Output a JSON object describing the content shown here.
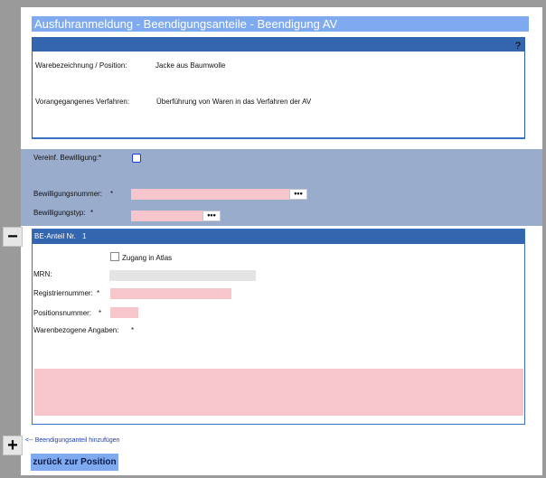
{
  "window": {
    "title": "Ausfuhranmeldung - Beendigungsanteile - Beendigung AV",
    "help_label": "?"
  },
  "position_info": {
    "warenbezeichnung_label": "Warebezeichnung / Position:",
    "warenbezeichnung_value": "Jacke aus Baumwolle",
    "verfahren_label": "Vorangegangenes Verfahren:",
    "verfahren_value": "Überführung von Waren in das Verfahren der AV"
  },
  "bewilligung": {
    "vereinf_label": "Vereinf. Bewilligung:*",
    "vereinf_checked": false,
    "nummer_label": "Bewilligungsnummer:",
    "nummer_required": "*",
    "nummer_value": "",
    "typ_label": "Bewilligungstyp:",
    "typ_required": "*",
    "typ_value": "",
    "lookup_label": "•••"
  },
  "be_anteil": {
    "header_label": "BE-Anteil Nr.",
    "header_number": "1",
    "zugang_label": "Zugang in Atlas",
    "zugang_checked": false,
    "mrn_label": "MRN:",
    "mrn_value": "",
    "registrier_label": "Registriernummer:",
    "registrier_required": "*",
    "registrier_value": "",
    "positions_label": "Positionsnummer:",
    "positions_required": "*",
    "positions_value": "",
    "warenbezogen_label": "Warenbezogene Angaben:",
    "warenbezogen_required": "*",
    "warenbezogen_value": ""
  },
  "controls": {
    "remove_symbol": "−",
    "add_symbol": "+",
    "add_link_label": "<-- Beendigungsanteil hinzufügen",
    "back_button_label": "zurück zur Position"
  },
  "colors": {
    "title_bar": "#7faaf0",
    "header_blue": "#3466b0",
    "band": "#9aaccc",
    "required_field": "#f6c6cc",
    "background": "#9a9a9a"
  }
}
